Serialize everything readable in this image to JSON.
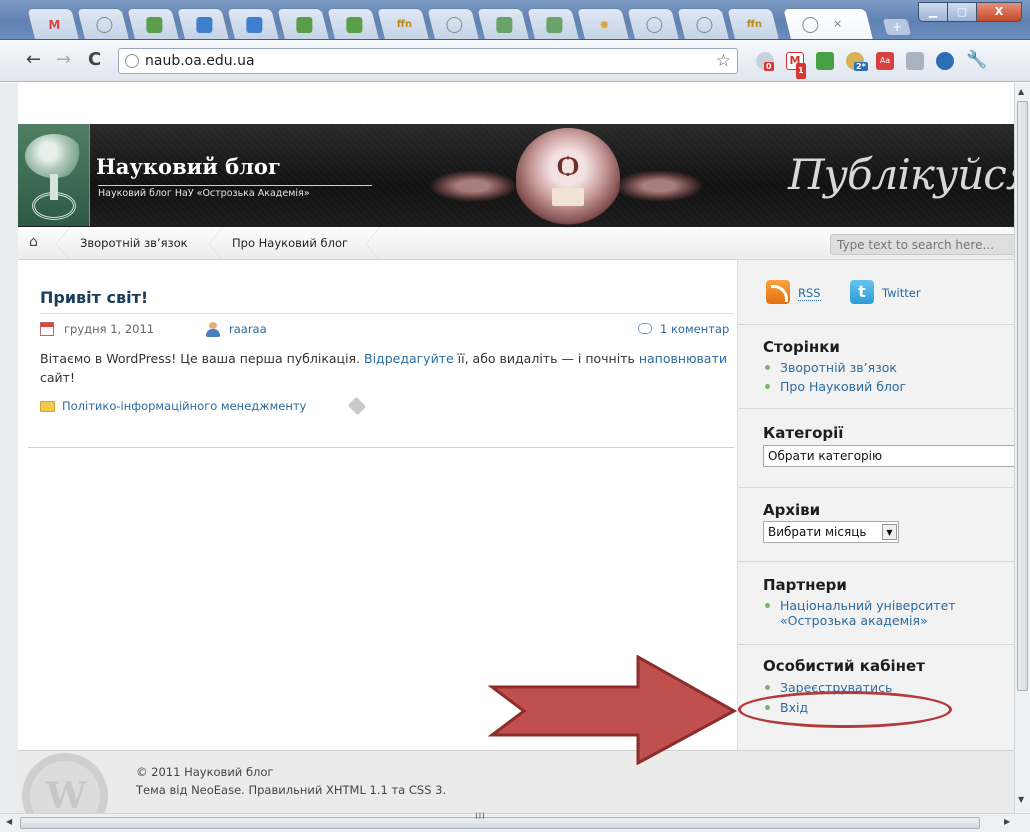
{
  "browser": {
    "url": "naub.oa.edu.ua",
    "tabs": [
      "M",
      "",
      "",
      "",
      "",
      "",
      "",
      "ffn",
      "",
      "",
      "",
      "",
      "",
      "",
      "ffn",
      ""
    ],
    "badges": [
      "0",
      "1",
      "2*"
    ]
  },
  "site": {
    "title": "Науковий блог",
    "subtitle": "Науковий блог НаУ «Острозька Академія»",
    "script_title": "Публікуйся",
    "nav": [
      "Зворотній зв’язок",
      "Про Науковий блог"
    ],
    "search_placeholder": "Type text to search here..."
  },
  "post": {
    "title": "Привіт світ!",
    "date": "грудня 1, 2011",
    "author": "raaraa",
    "comments": "1 коментар",
    "body_1": "Вітаємо в WordPress! Це ваша перша публікація. ",
    "body_link_edit": "Відредагуйте",
    "body_2": " її, або видаліть — і почніть ",
    "body_link_fill": "наповнювати",
    "body_3": " сайт!",
    "category": "Політико-інформаційного менеджменту"
  },
  "sidebar": {
    "rss": "RSS",
    "twitter": "Twitter",
    "pages_title": "Сторінки",
    "pages": [
      "Зворотній зв’язок",
      "Про Науковий блог"
    ],
    "categories_title": "Категорії",
    "categories_select": "Обрати категорію",
    "archives_title": "Архіви",
    "archives_select": "Вибрати місяць",
    "partners_title": "Партнери",
    "partner_1": "Національний університет",
    "partner_2": "«Острозька академія»",
    "cabinet_title": "Особистий кабінет",
    "register": "Зареєструватись",
    "login": "Вхід"
  },
  "footer": {
    "copyright": "© 2011 Науковий блог",
    "theme_prefix": "Тема від ",
    "theme_link": "NeoEase",
    "theme_suffix": ". Правильний ",
    "xhtml": "XHTML 1.1",
    "and": " та ",
    "css": "CSS 3",
    "end": "."
  },
  "colors": {
    "accent_link": "#2b6aa0",
    "annotation_red": "#b23a3a"
  }
}
